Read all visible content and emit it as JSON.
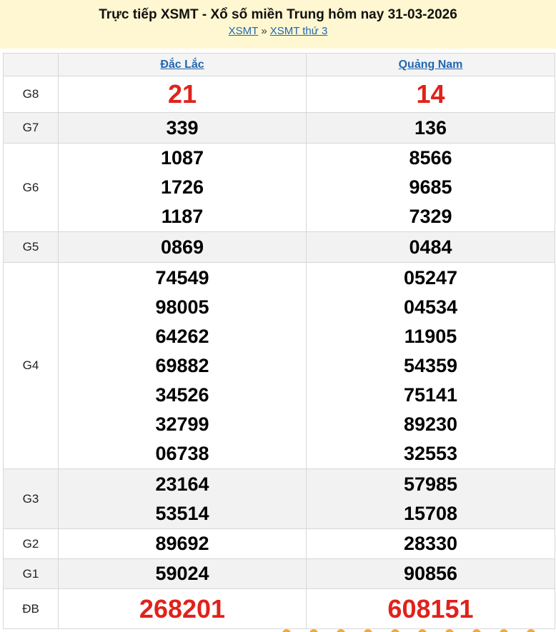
{
  "header": {
    "title": "Trực tiếp XSMT - Xổ số miền Trung hôm nay 31-03-2026",
    "crumb_home": "XSMT",
    "crumb_sep": "»",
    "crumb_current": "XSMT thứ 3"
  },
  "provinces": [
    "Đắc Lắc",
    "Quảng Nam"
  ],
  "prizes": {
    "g8": {
      "label": "G8",
      "p1": [
        "21"
      ],
      "p2": [
        "14"
      ]
    },
    "g7": {
      "label": "G7",
      "p1": [
        "339"
      ],
      "p2": [
        "136"
      ]
    },
    "g6": {
      "label": "G6",
      "p1": [
        "1087",
        "1726",
        "1187"
      ],
      "p2": [
        "8566",
        "9685",
        "7329"
      ]
    },
    "g5": {
      "label": "G5",
      "p1": [
        "0869"
      ],
      "p2": [
        "0484"
      ]
    },
    "g4": {
      "label": "G4",
      "p1": [
        "74549",
        "98005",
        "64262",
        "69882",
        "34526",
        "32799",
        "06738"
      ],
      "p2": [
        "05247",
        "04534",
        "11905",
        "54359",
        "75141",
        "89230",
        "32553"
      ]
    },
    "g3": {
      "label": "G3",
      "p1": [
        "23164",
        "53514"
      ],
      "p2": [
        "57985",
        "15708"
      ]
    },
    "g2": {
      "label": "G2",
      "p1": [
        "89692"
      ],
      "p2": [
        "28330"
      ]
    },
    "g1": {
      "label": "G1",
      "p1": [
        "59024"
      ],
      "p2": [
        "90856"
      ]
    },
    "db": {
      "label": "ĐB",
      "p1": [
        "268201"
      ],
      "p2": [
        "608151"
      ]
    }
  },
  "colors": {
    "highlight": "#e0221b",
    "link": "#1f67b1",
    "header_bg": "#fff7d1"
  }
}
